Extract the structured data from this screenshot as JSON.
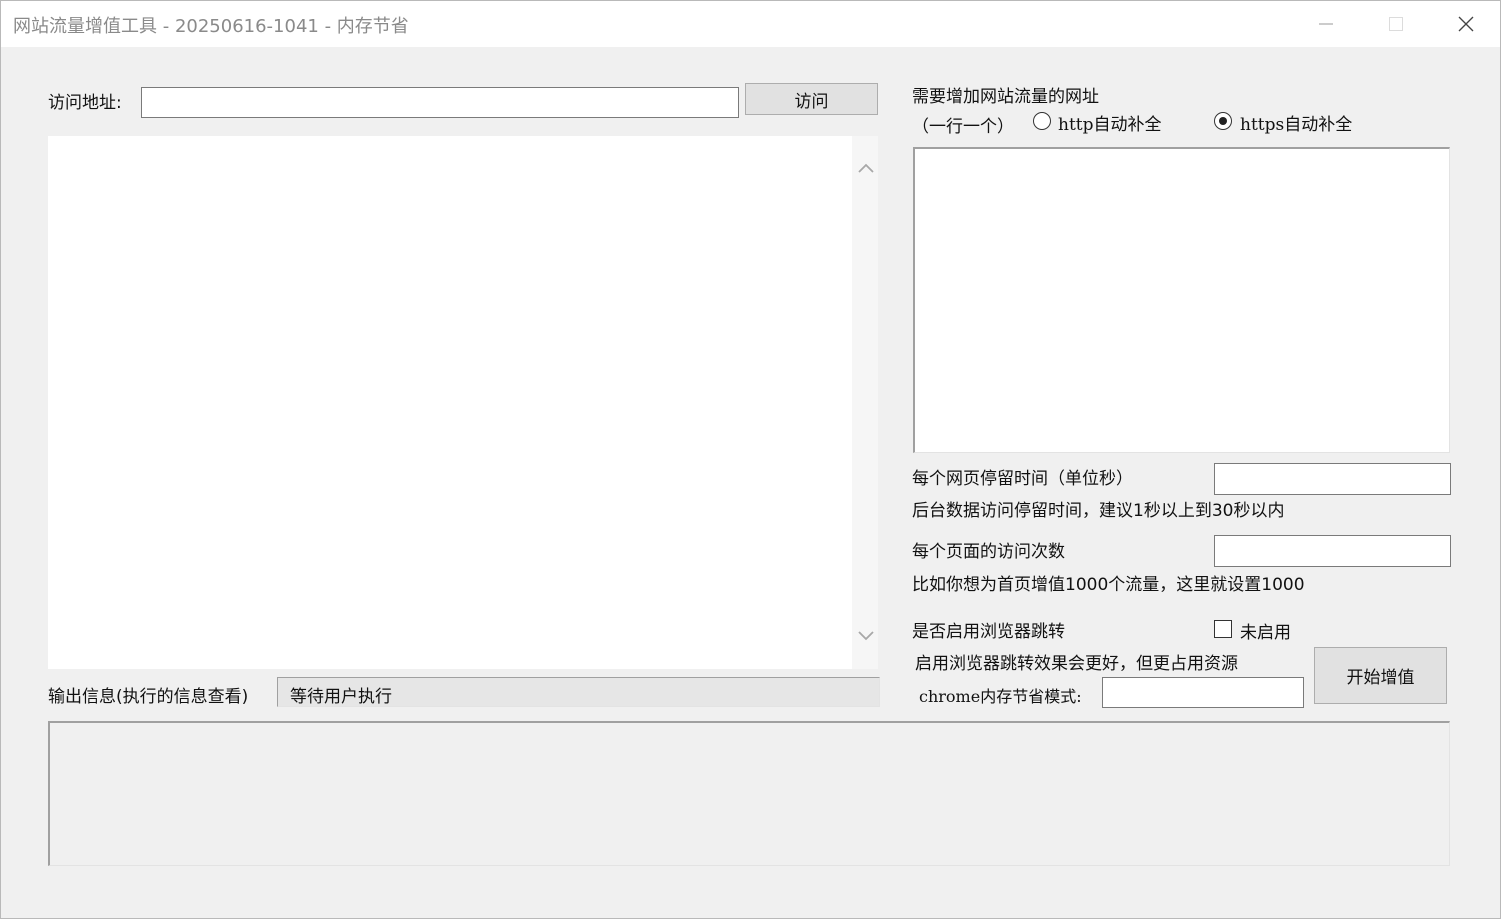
{
  "window": {
    "title": "网站流量增值工具 - 20250616-1041 - 内存节省",
    "minimize_icon": "minimize-icon",
    "maximize_icon": "maximize-icon",
    "close_icon": "close-icon"
  },
  "browser": {
    "address_label": "访问地址:",
    "address_value": "",
    "visit_button": "访问"
  },
  "urls": {
    "heading": "需要增加网站流量的网址",
    "subheading": "（一行一个）",
    "radio_http_label": "http自动补全",
    "radio_https_label": "https自动补全",
    "selected": "https",
    "value": ""
  },
  "settings": {
    "stay_time_label": "每个网页停留时间（单位秒）",
    "stay_time_hint": "后台数据访问停留时间，建议1秒以上到30秒以内",
    "stay_time_value": "",
    "visit_count_label": "每个页面的访问次数",
    "visit_count_hint": "比如你想为首页增值1000个流量，这里就设置1000",
    "visit_count_value": "",
    "redirect_label": "是否启用浏览器跳转",
    "redirect_checkbox_label": "未启用",
    "redirect_checked": false,
    "redirect_hint": "启用浏览器跳转效果会更好，但更占用资源",
    "memory_mode_label": "chrome内存节省模式:",
    "memory_mode_value": "",
    "start_button": "开始增值"
  },
  "output": {
    "label": "输出信息(执行的信息查看)",
    "status": "等待用户执行",
    "log": ""
  }
}
